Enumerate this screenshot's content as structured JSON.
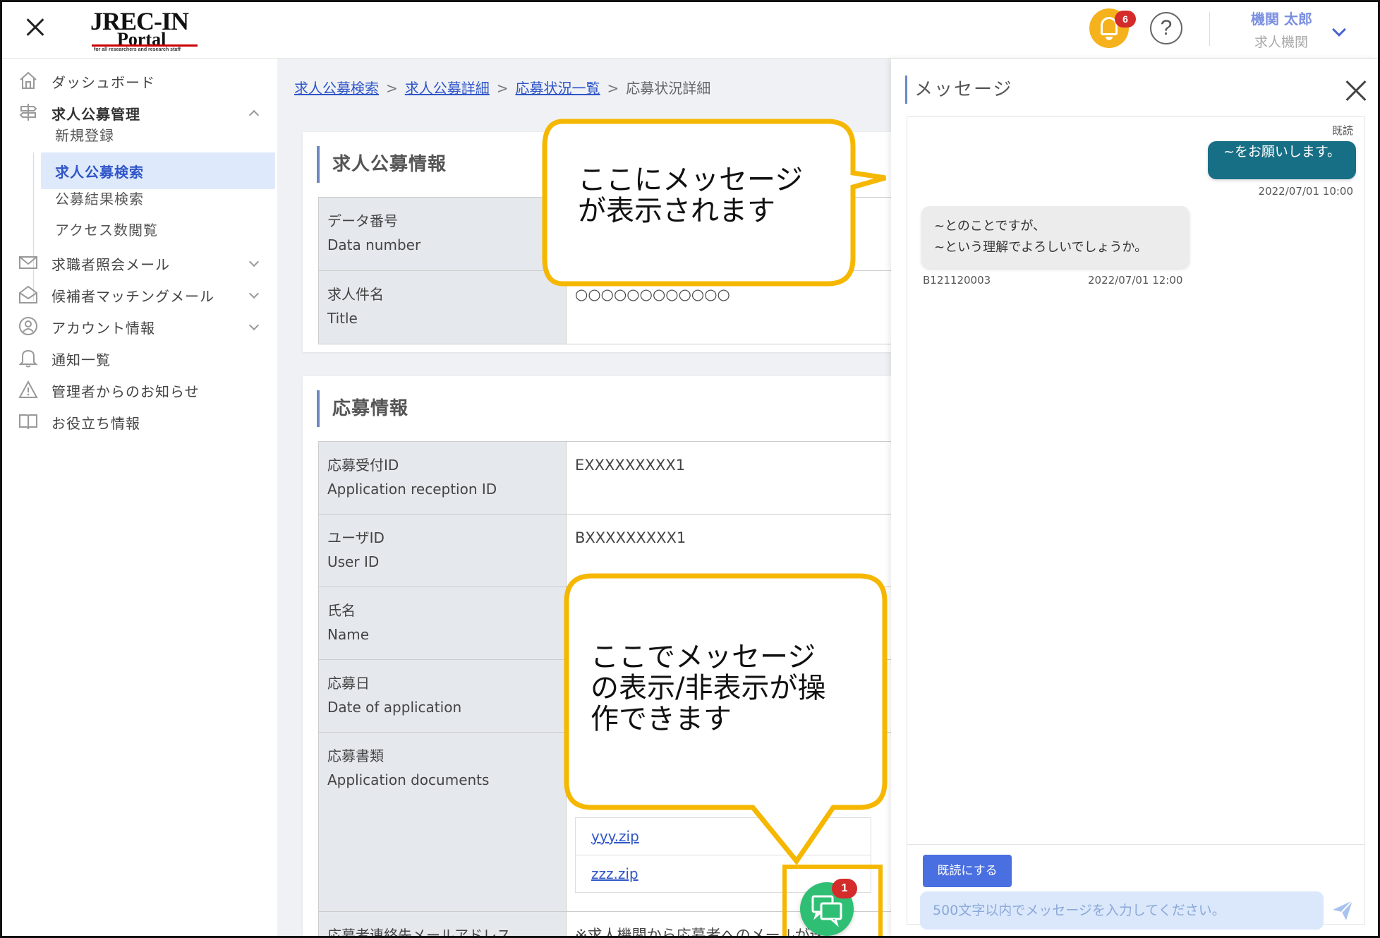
{
  "header": {
    "logo_text_top": "JREC-IN",
    "logo_text_bottom": "Portal",
    "logo_tagline": "for all researchers and research staff",
    "notification_count": "6",
    "help_icon": "?",
    "user_name": "機関 太郎",
    "user_org": "求人機関"
  },
  "sidebar": {
    "items": [
      {
        "label": "ダッシュボード",
        "icon": "home-icon"
      },
      {
        "label": "求人公募管理",
        "icon": "signpost-icon"
      },
      {
        "label": "求職者照会メール",
        "icon": "mail-icon"
      },
      {
        "label": "候補者マッチングメール",
        "icon": "mail-open-icon"
      },
      {
        "label": "アカウント情報",
        "icon": "user-icon"
      },
      {
        "label": "通知一覧",
        "icon": "bell-icon"
      },
      {
        "label": "管理者からのお知らせ",
        "icon": "warning-icon"
      },
      {
        "label": "お役立ち情報",
        "icon": "book-icon"
      }
    ],
    "sub_items": [
      {
        "label": "新規登録"
      },
      {
        "label": "求人公募検索"
      },
      {
        "label": "公募結果検索"
      },
      {
        "label": "アクセス数閲覧"
      }
    ]
  },
  "breadcrumb": {
    "items": [
      "求人公募検索",
      "求人公募詳細",
      "応募状況一覧"
    ],
    "current": "応募状況詳細",
    "separator": ">"
  },
  "job_card": {
    "title": "求人公募情報",
    "rows": [
      {
        "label_ja": "データ番号",
        "label_en": "Data number",
        "value": ""
      },
      {
        "label_ja": "求人件名",
        "label_en": "Title",
        "value": "○○○○○○○○○○○○"
      }
    ]
  },
  "app_card": {
    "title": "応募情報",
    "rows": [
      {
        "label_ja": "応募受付ID",
        "label_en": "Application reception ID",
        "value": "EXXXXXXXXX1"
      },
      {
        "label_ja": "ユーザID",
        "label_en": "User ID",
        "value": "BXXXXXXXXX1"
      },
      {
        "label_ja": "氏名",
        "label_en": "Name",
        "value": ""
      },
      {
        "label_ja": "応募日",
        "label_en": "Date of application",
        "value": ""
      },
      {
        "label_ja": "応募書類",
        "label_en": "Application documents",
        "value": ""
      },
      {
        "label_ja": "応募者連絡先メールアドレス",
        "label_en": "",
        "value": "※求人機関から応募者へのメールが送"
      }
    ],
    "documents": [
      "yyy.zip",
      "zzz.zip"
    ]
  },
  "message_panel": {
    "title": "メッセージ",
    "read_flag": "既読",
    "outgoing": {
      "text": "~をお願いします。",
      "time": "2022/07/01 10:00"
    },
    "incoming": {
      "line1": "~とのことですが、",
      "line2": "~という理解でよろしいでしょうか。",
      "sender": "B121120003",
      "time": "2022/07/01 12:00"
    },
    "mark_read_button": "既読にする",
    "input_placeholder": "500文字以内でメッセージを入力してください。"
  },
  "chat_fab": {
    "badge": "1"
  },
  "callouts": {
    "top": "ここにメッセージ\nが表示されます",
    "bottom": "ここでメッセージ\nの表示/非表示が操\n作できます"
  },
  "colors": {
    "accent": "#4a6fe0",
    "callout_border": "#f5b700",
    "bubble_out": "#176f86",
    "chat_fab": "#2fbf74",
    "badge": "#d42b2b",
    "bell": "#f5b21c"
  }
}
